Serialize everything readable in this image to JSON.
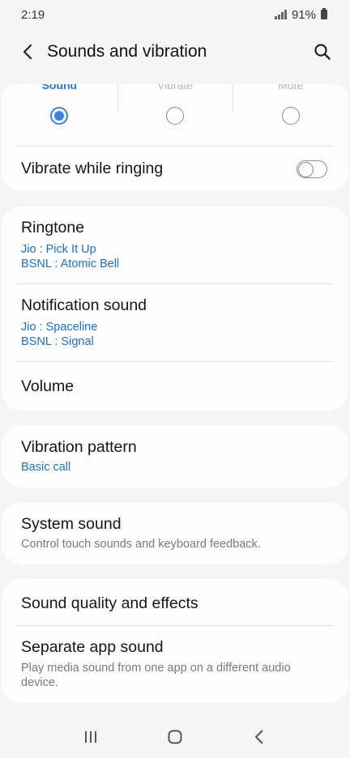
{
  "status": {
    "time": "2:19",
    "battery": "91%"
  },
  "header": {
    "title": "Sounds and vibration"
  },
  "mode": {
    "options": [
      "Sound",
      "Vibrate",
      "Mute"
    ],
    "selected": "Sound"
  },
  "vibrate_while_ringing": {
    "label": "Vibrate while ringing",
    "enabled": false
  },
  "ringtone": {
    "title": "Ringtone",
    "lines": [
      "Jio : Pick It Up",
      "BSNL : Atomic Bell"
    ]
  },
  "notification_sound": {
    "title": "Notification sound",
    "lines": [
      "Jio : Spaceline",
      "BSNL : Signal"
    ]
  },
  "volume": {
    "title": "Volume"
  },
  "vibration_pattern": {
    "title": "Vibration pattern",
    "value": "Basic call"
  },
  "system_sound": {
    "title": "System sound",
    "desc": "Control touch sounds and keyboard feedback."
  },
  "sound_quality": {
    "title": "Sound quality and effects"
  },
  "separate_app_sound": {
    "title": "Separate app sound",
    "desc": "Play media sound from one app on a different audio device."
  },
  "colors": {
    "accent": "#3b82e0",
    "link": "#1f6fc0",
    "background": "#f5f5f5",
    "card": "#fdfdfd"
  },
  "icons": {
    "back": "chevron-left-icon",
    "search": "search-icon",
    "recents": "recents-icon",
    "home": "home-icon",
    "nav_back": "back-icon"
  }
}
